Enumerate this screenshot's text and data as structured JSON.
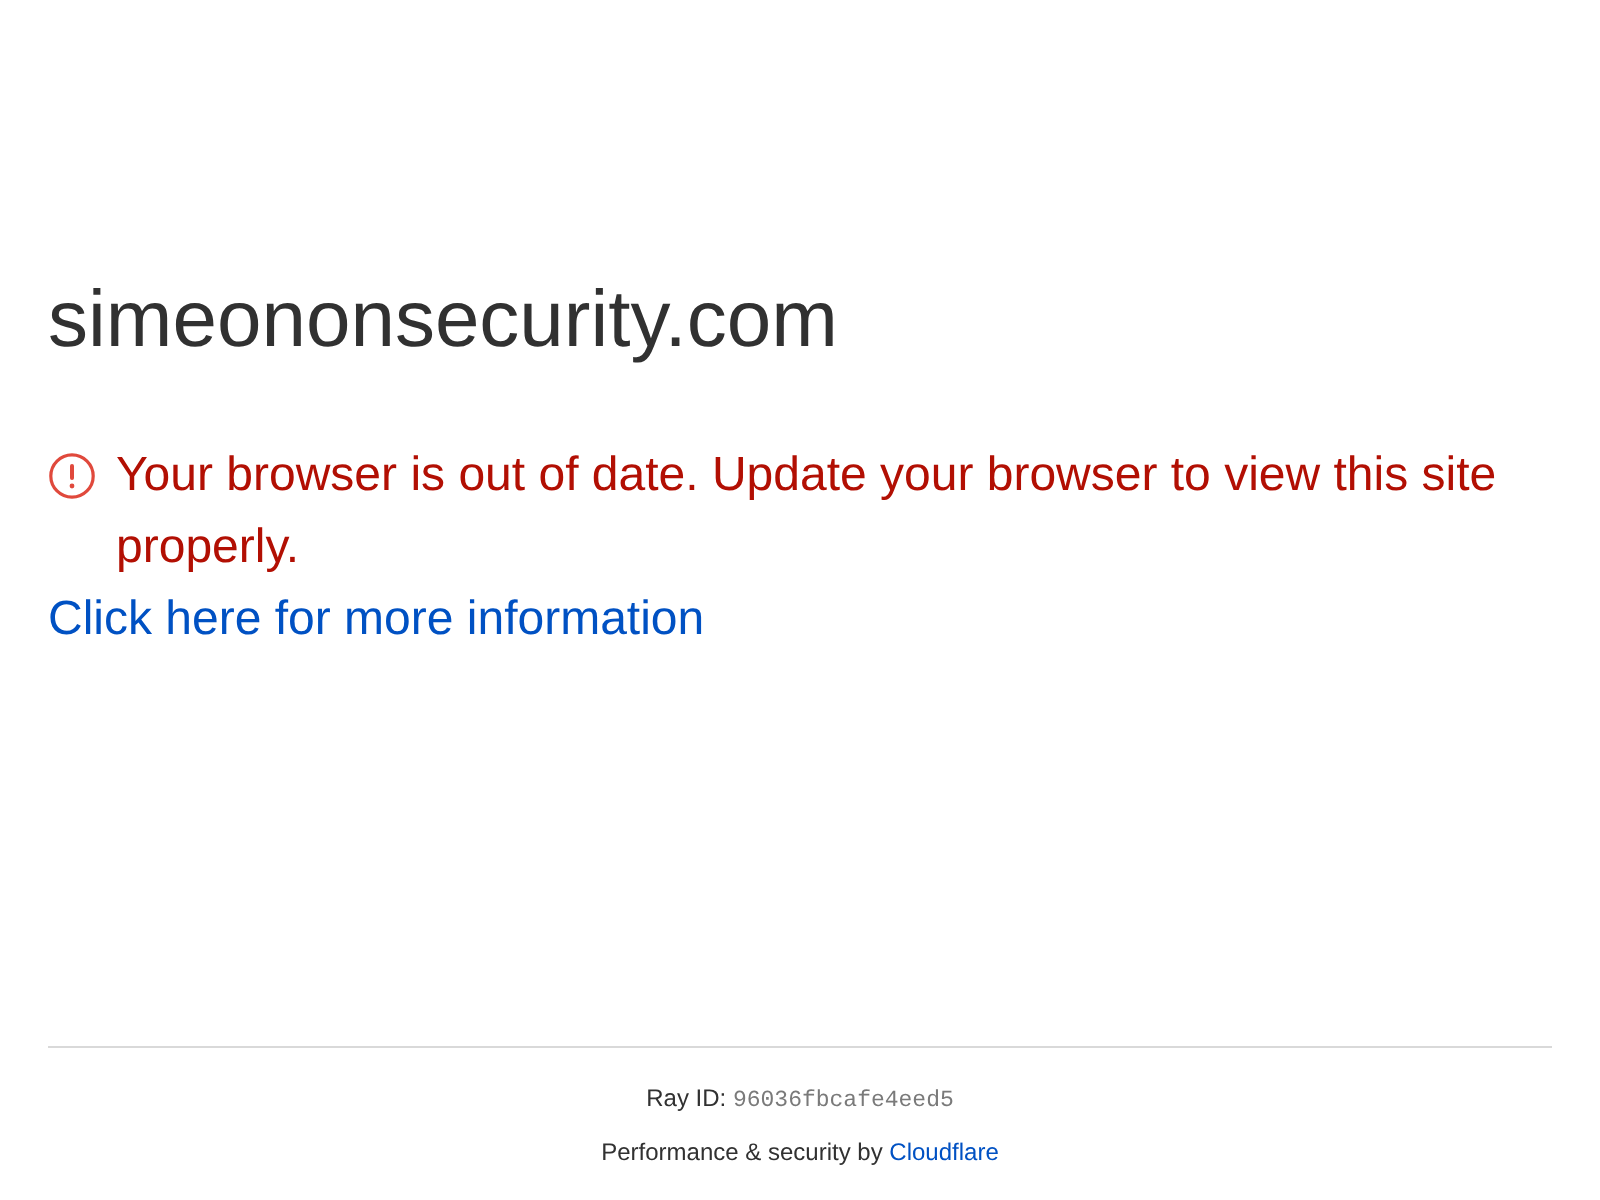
{
  "site": {
    "title": "simeononsecurity.com"
  },
  "alert": {
    "message": "Your browser is out of date. Update your browser to view this site properly.",
    "link": "Click here for more information"
  },
  "footer": {
    "ray_id_label": "Ray ID:",
    "ray_id": "96036fbcafe4eed5",
    "credit": "Performance & security by",
    "credit_link": "Cloudflare"
  }
}
